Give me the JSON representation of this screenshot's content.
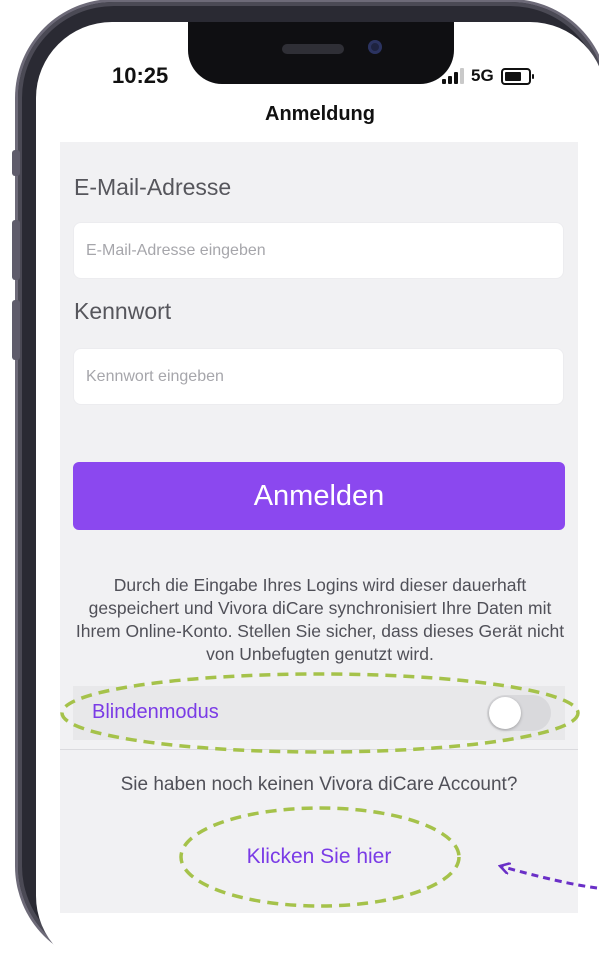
{
  "status_bar": {
    "time": "10:25",
    "network": "5G"
  },
  "nav": {
    "title": "Anmeldung"
  },
  "form": {
    "email_label": "E-Mail-Adresse",
    "email_placeholder": "E-Mail-Adresse eingeben",
    "email_value": "",
    "password_label": "Kennwort",
    "password_placeholder": "Kennwort eingeben",
    "password_value": "",
    "login_button": "Anmelden"
  },
  "info_text": "Durch die Eingabe Ihres Logins wird dieser dauerhaft gespeichert und Vivora diCare synchronisiert Ihre Daten mit Ihrem Online-Konto. Stellen Sie sicher, dass dieses Gerät nicht von Unbefugten genutzt wird.",
  "blind_mode": {
    "label": "Blindenmodus",
    "enabled": false
  },
  "signup": {
    "prompt": "Sie haben noch keinen Vivora diCare Account?",
    "link": "Klicken Sie hier"
  },
  "colors": {
    "accent": "#8b48ef",
    "link": "#7a3be6",
    "highlight_ring": "#a5c24a",
    "arrow": "#6a2fc7"
  }
}
